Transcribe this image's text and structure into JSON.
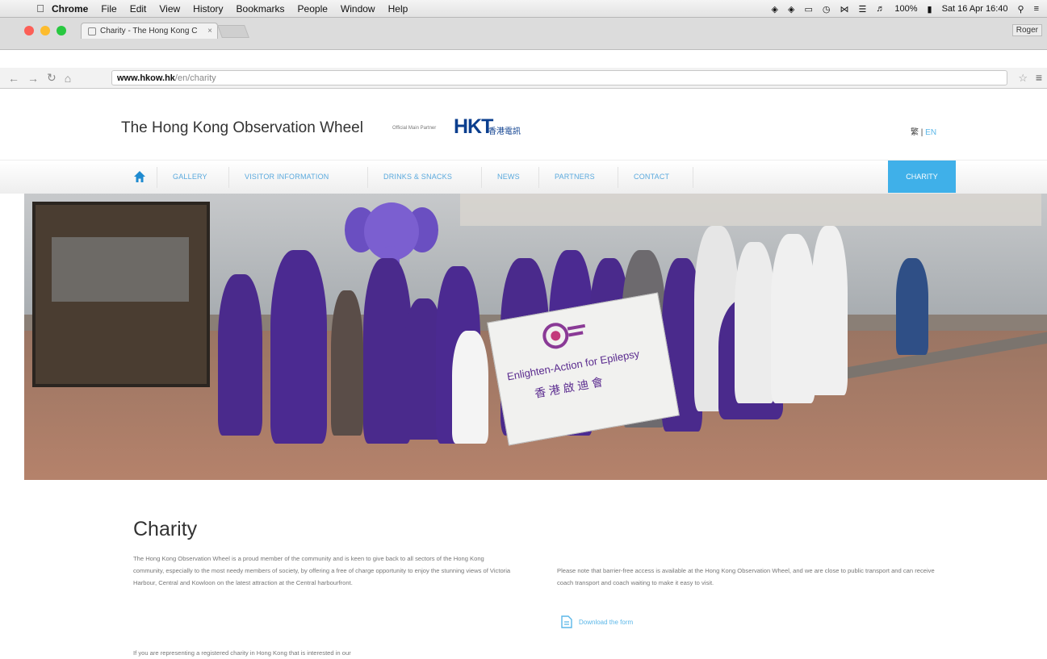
{
  "menubar": {
    "app": "Chrome",
    "items": [
      "File",
      "Edit",
      "View",
      "History",
      "Bookmarks",
      "People",
      "Window",
      "Help"
    ],
    "battery": "100%",
    "datetime": "Sat 16 Apr  16:40"
  },
  "browser": {
    "tab_title": "Charity - The Hong Kong C",
    "profile": "Roger",
    "url_domain": "www.hkow.hk",
    "url_path": "/en/charity"
  },
  "site": {
    "title": "The Hong Kong Observation Wheel",
    "sponsor_label": "Official Main Partner",
    "sponsor_logo": "HKT",
    "sponsor_cn": "香港電訊",
    "lang_zh": "繁",
    "lang_sep": "|",
    "lang_en": "EN"
  },
  "nav": {
    "items": [
      "GALLERY",
      "VISITOR INFORMATION",
      "DRINKS & SNACKS",
      "NEWS",
      "PARTNERS",
      "CONTACT"
    ],
    "active": "CHARITY"
  },
  "hero": {
    "banner_text": "Enlighten-Action for Epilepsy",
    "banner_cn": "香 港 啟 迪 會"
  },
  "content": {
    "title": "Charity",
    "para1": "The Hong Kong Observation Wheel is a proud member of the community and is keen to give back to all sectors of the Hong Kong community, especially to the most needy members of society, by offering a free of charge opportunity to enjoy the stunning views of Victoria Harbour, Central and Kowloon on the latest attraction at the Central harbourfront.",
    "para2": "Please note that barrier-free access is available at the Hong Kong Observation Wheel, and we are close to public transport and can receive coach transport and coach waiting to make it easy to visit.",
    "download": "Download the form",
    "para3": "If you are representing a registered charity in Hong Kong that is interested in our"
  },
  "colors": {
    "accent": "#3fb0e9",
    "link": "#5aa9dd",
    "hkt_blue": "#0b3e8e",
    "purple": "#5b2c8f"
  }
}
